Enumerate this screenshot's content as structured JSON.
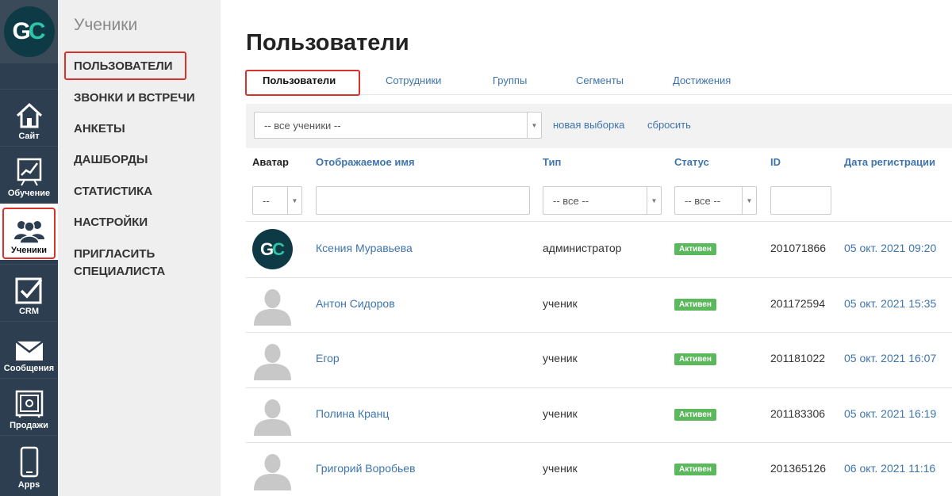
{
  "logo": {
    "g": "G",
    "c": "C"
  },
  "rail": [
    {
      "label": "Сайт",
      "icon": "house-icon"
    },
    {
      "label": "Обучение",
      "icon": "chart-board-icon"
    },
    {
      "label": "Ученики",
      "icon": "users-group-icon",
      "active": true
    },
    {
      "label": "CRM",
      "icon": "checkbox-icon"
    },
    {
      "label": "Сообщения",
      "icon": "envelope-icon"
    },
    {
      "label": "Продажи",
      "icon": "safe-icon"
    },
    {
      "label": "Apps",
      "icon": "smartphone-icon"
    }
  ],
  "subnav": {
    "title": "Ученики",
    "items": [
      {
        "label": "ПОЛЬЗОВАТЕЛИ"
      },
      {
        "label": "ЗВОНКИ И ВСТРЕЧИ"
      },
      {
        "label": "АНКЕТЫ"
      },
      {
        "label": "ДАШБОРДЫ"
      },
      {
        "label": "СТАТИСТИКА"
      },
      {
        "label": "НАСТРОЙКИ"
      },
      {
        "label": "ПРИГЛАСИТЬ СПЕЦИАЛИСТА"
      }
    ]
  },
  "main": {
    "title": "Пользователи",
    "tabs": [
      {
        "label": "Пользователи"
      },
      {
        "label": "Сотрудники"
      },
      {
        "label": "Группы"
      },
      {
        "label": "Сегменты"
      },
      {
        "label": "Достижения"
      }
    ],
    "filter": {
      "segment_value": "-- все ученики --",
      "new_selection": "новая выборка",
      "reset": "сбросить"
    },
    "columns": [
      "Аватар",
      "Отображаемое имя",
      "Тип",
      "Статус",
      "ID",
      "Дата регистрации"
    ],
    "column_filters": {
      "avatar": "--",
      "type": "-- все --",
      "status": "-- все --"
    },
    "rows": [
      {
        "name": "Ксения Муравьева",
        "type": "администратор",
        "status": "Активен",
        "id": "201071866",
        "date": "05 окт. 2021 09:20",
        "avatar": "gc"
      },
      {
        "name": "Антон Сидоров",
        "type": "ученик",
        "status": "Активен",
        "id": "201172594",
        "date": "05 окт. 2021 15:35",
        "avatar": "default"
      },
      {
        "name": "Егор",
        "type": "ученик",
        "status": "Активен",
        "id": "201181022",
        "date": "05 окт. 2021 16:07",
        "avatar": "default"
      },
      {
        "name": "Полина Кранц",
        "type": "ученик",
        "status": "Активен",
        "id": "201183306",
        "date": "05 окт. 2021 16:19",
        "avatar": "default"
      },
      {
        "name": "Григорий Воробьев",
        "type": "ученик",
        "status": "Активен",
        "id": "201365126",
        "date": "06 окт. 2021 11:16",
        "avatar": "default"
      }
    ]
  },
  "colors": {
    "rail_bg": "#2c3e50",
    "accent_link": "#3e74ad",
    "highlight": "#d9312b",
    "status_active": "#5cb85c",
    "brand_dark": "#0e3a45",
    "brand_teal": "#2ec4a6"
  }
}
